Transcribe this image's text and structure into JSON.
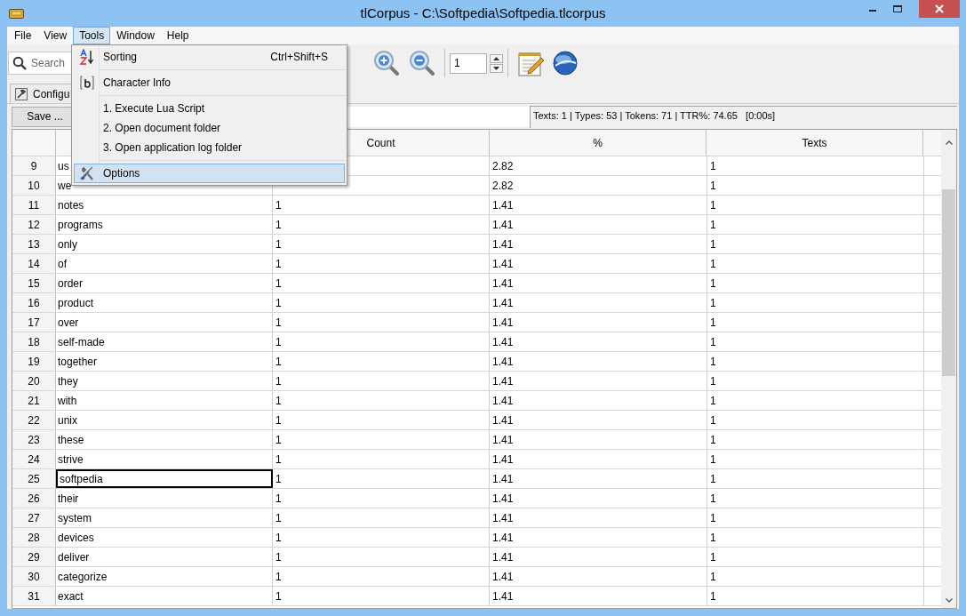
{
  "window": {
    "title": "tlCorpus - C:\\Softpedia\\Softpedia.tlcorpus"
  },
  "menu_bar": [
    {
      "label": "File",
      "selected": false
    },
    {
      "label": "View",
      "selected": false
    },
    {
      "label": "Tools",
      "selected": true
    },
    {
      "label": "Window",
      "selected": false
    },
    {
      "label": "Help",
      "selected": false
    }
  ],
  "tools_menu": [
    {
      "kind": "item",
      "label": "Sorting",
      "shortcut": "Ctrl+Shift+S",
      "selected": false
    },
    {
      "kind": "separator"
    },
    {
      "kind": "item",
      "label": "Character Info",
      "selected": false
    },
    {
      "kind": "separator"
    },
    {
      "kind": "item",
      "label": "1. Execute Lua Script",
      "selected": false
    },
    {
      "kind": "item",
      "label": "2. Open document folder",
      "selected": false
    },
    {
      "kind": "item",
      "label": "3. Open application log folder",
      "selected": false
    },
    {
      "kind": "separator"
    },
    {
      "kind": "item",
      "label": "Options",
      "selected": true
    }
  ],
  "toolbar": {
    "search": {
      "placeholder": "Search"
    },
    "page_field": {
      "value": "1"
    }
  },
  "tab": {
    "label": "Configu"
  },
  "save_button": {
    "label": "Save ..."
  },
  "stats": "Texts: 1 | Types: 53 | Tokens: 71 | TTR%: 74.65   [0:00s]",
  "table": {
    "columns": [
      "Count",
      "%",
      "Texts"
    ],
    "rows": [
      {
        "n": "9",
        "word": "us",
        "pct": "2.82",
        "texts": "1",
        "selected": false
      },
      {
        "n": "10",
        "word": "we",
        "pct": "2.82",
        "texts": "1",
        "selected": false
      },
      {
        "n": "11",
        "word": "notes",
        "count": "1",
        "pct": "1.41",
        "texts": "1",
        "selected": false
      },
      {
        "n": "12",
        "word": "programs",
        "count": "1",
        "pct": "1.41",
        "texts": "1",
        "selected": false
      },
      {
        "n": "13",
        "word": "only",
        "count": "1",
        "pct": "1.41",
        "texts": "1",
        "selected": false
      },
      {
        "n": "14",
        "word": "of",
        "count": "1",
        "pct": "1.41",
        "texts": "1",
        "selected": false
      },
      {
        "n": "15",
        "word": "order",
        "count": "1",
        "pct": "1.41",
        "texts": "1",
        "selected": false
      },
      {
        "n": "16",
        "word": "product",
        "count": "1",
        "pct": "1.41",
        "texts": "1",
        "selected": false
      },
      {
        "n": "17",
        "word": "over",
        "count": "1",
        "pct": "1.41",
        "texts": "1",
        "selected": false
      },
      {
        "n": "18",
        "word": "self-made",
        "count": "1",
        "pct": "1.41",
        "texts": "1",
        "selected": false
      },
      {
        "n": "19",
        "word": "together",
        "count": "1",
        "pct": "1.41",
        "texts": "1",
        "selected": false
      },
      {
        "n": "20",
        "word": "they",
        "count": "1",
        "pct": "1.41",
        "texts": "1",
        "selected": false
      },
      {
        "n": "21",
        "word": "with",
        "count": "1",
        "pct": "1.41",
        "texts": "1",
        "selected": false
      },
      {
        "n": "22",
        "word": "unix",
        "count": "1",
        "pct": "1.41",
        "texts": "1",
        "selected": false
      },
      {
        "n": "23",
        "word": "these",
        "count": "1",
        "pct": "1.41",
        "texts": "1",
        "selected": false
      },
      {
        "n": "24",
        "word": "strive",
        "count": "1",
        "pct": "1.41",
        "texts": "1",
        "selected": false
      },
      {
        "n": "25",
        "word": "softpedia",
        "count": "1",
        "pct": "1.41",
        "texts": "1",
        "selected": true
      },
      {
        "n": "26",
        "word": "their",
        "count": "1",
        "pct": "1.41",
        "texts": "1",
        "selected": false
      },
      {
        "n": "27",
        "word": "system",
        "count": "1",
        "pct": "1.41",
        "texts": "1",
        "selected": false
      },
      {
        "n": "28",
        "word": "devices",
        "count": "1",
        "pct": "1.41",
        "texts": "1",
        "selected": false
      },
      {
        "n": "29",
        "word": "deliver",
        "count": "1",
        "pct": "1.41",
        "texts": "1",
        "selected": false
      },
      {
        "n": "30",
        "word": "categorize",
        "count": "1",
        "pct": "1.41",
        "texts": "1",
        "selected": false
      },
      {
        "n": "31",
        "word": "exact",
        "count": "1",
        "pct": "1.41",
        "texts": "1",
        "selected": false
      }
    ]
  }
}
